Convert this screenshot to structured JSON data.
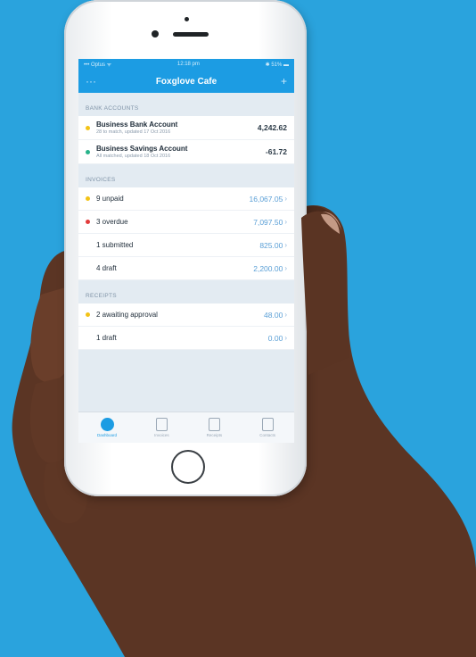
{
  "status_bar": {
    "carrier": "••• Optus ᯤ",
    "time": "12:18 pm",
    "battery": "✱ 51% ▬"
  },
  "nav": {
    "title": "Foxglove Cafe",
    "menu_icon": "ellipsis-icon",
    "add_icon": "plus-icon"
  },
  "bank_accounts": {
    "header": "BANK ACCOUNTS",
    "items": [
      {
        "name": "Business Bank Account",
        "detail": "28 to match, updated 17 Oct 2016",
        "amount": "4,242.62",
        "color": "#f3c316"
      },
      {
        "name": "Business Savings Account",
        "detail": "All matched, updated 18 Oct 2016",
        "amount": "-61.72",
        "color": "#27b38a"
      }
    ]
  },
  "invoices": {
    "header": "INVOICES",
    "items": [
      {
        "label": "9 unpaid",
        "amount": "16,067.05",
        "color": "#f3c316"
      },
      {
        "label": "3 overdue",
        "amount": "7,097.50",
        "color": "#e23b3b"
      },
      {
        "label": "1 submitted",
        "amount": "825.00",
        "color": ""
      },
      {
        "label": "4 draft",
        "amount": "2,200.00",
        "color": ""
      }
    ]
  },
  "receipts": {
    "header": "RECEIPTS",
    "items": [
      {
        "label": "2 awaiting approval",
        "amount": "48.00",
        "color": "#f3c316"
      },
      {
        "label": "1 draft",
        "amount": "0.00",
        "color": ""
      }
    ]
  },
  "tabs": [
    {
      "label": "Dashboard",
      "icon": "dashboard-icon",
      "active": true
    },
    {
      "label": "Invoices",
      "icon": "invoice-icon",
      "active": false
    },
    {
      "label": "Receipts",
      "icon": "receipt-icon",
      "active": false
    },
    {
      "label": "Contacts",
      "icon": "contacts-icon",
      "active": false
    }
  ],
  "colors": {
    "background": "#2aa3dd",
    "accent": "#1c9ce3"
  }
}
